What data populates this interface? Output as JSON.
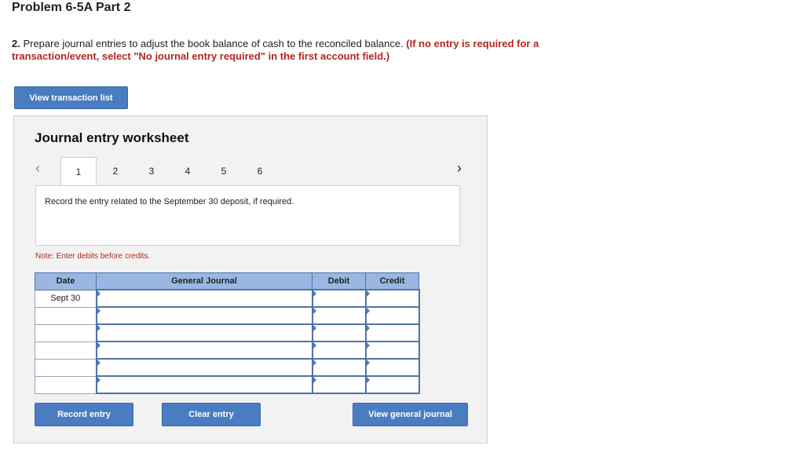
{
  "page": {
    "title": "Problem 6-5A Part 2",
    "instruction_num": "2.",
    "instruction_text": " Prepare journal entries to adjust the book balance of cash to the reconciled balance. ",
    "instruction_red": "(If no entry is required for a transaction/event, select \"No journal entry required\" in the first account field.)",
    "view_list_label": "View transaction list"
  },
  "worksheet": {
    "title": "Journal entry worksheet",
    "tabs": [
      "1",
      "2",
      "3",
      "4",
      "5",
      "6"
    ],
    "active_tab": "1",
    "prompt": "Record the entry related to the September 30 deposit, if required.",
    "note": "Note: Enter debits before credits.",
    "columns": {
      "date": "Date",
      "general_journal": "General Journal",
      "debit": "Debit",
      "credit": "Credit"
    },
    "rows": [
      {
        "date": "Sept 30"
      },
      {
        "date": ""
      },
      {
        "date": ""
      },
      {
        "date": ""
      },
      {
        "date": ""
      },
      {
        "date": ""
      }
    ],
    "buttons": {
      "record": "Record entry",
      "clear": "Clear entry",
      "view_general_journal": "View general journal"
    }
  }
}
